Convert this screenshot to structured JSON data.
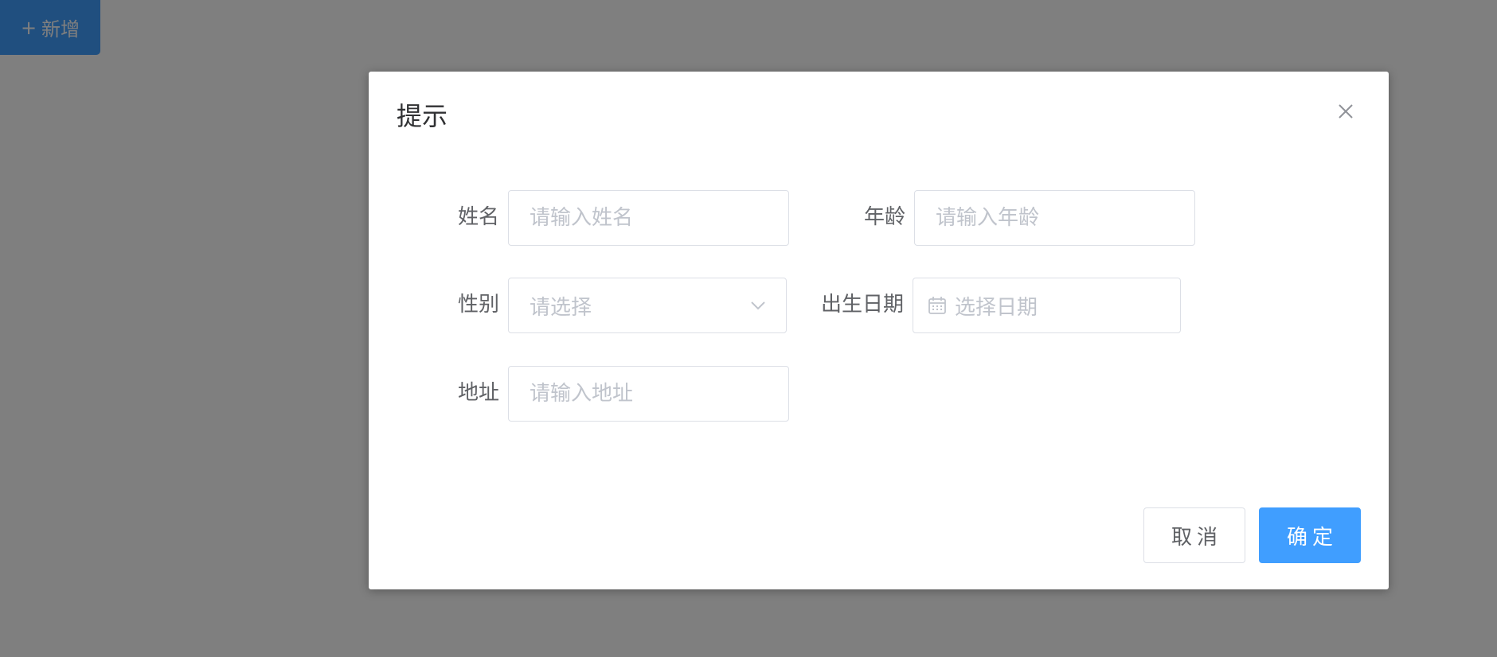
{
  "toolbar": {
    "add_plus": "+",
    "add_label": "新增"
  },
  "dialog": {
    "title": "提示",
    "close_icon": "close-icon"
  },
  "form": {
    "name": {
      "label": "姓名",
      "placeholder": "请输入姓名",
      "value": ""
    },
    "age": {
      "label": "年龄",
      "placeholder": "请输入年龄",
      "value": ""
    },
    "gender": {
      "label": "性别",
      "placeholder": "请选择",
      "icon": "chevron-down-icon"
    },
    "birthdate": {
      "label": "出生日期",
      "placeholder": "选择日期",
      "icon": "calendar-icon"
    },
    "address": {
      "label": "地址",
      "placeholder": "请输入地址",
      "value": ""
    }
  },
  "footer": {
    "cancel_label": "取消",
    "confirm_label": "确定"
  },
  "colors": {
    "primary": "#409eff",
    "overlay": "rgba(0,0,0,0.5)",
    "border": "#dcdfe6",
    "placeholder": "#c0c4cc",
    "label": "#606266"
  }
}
